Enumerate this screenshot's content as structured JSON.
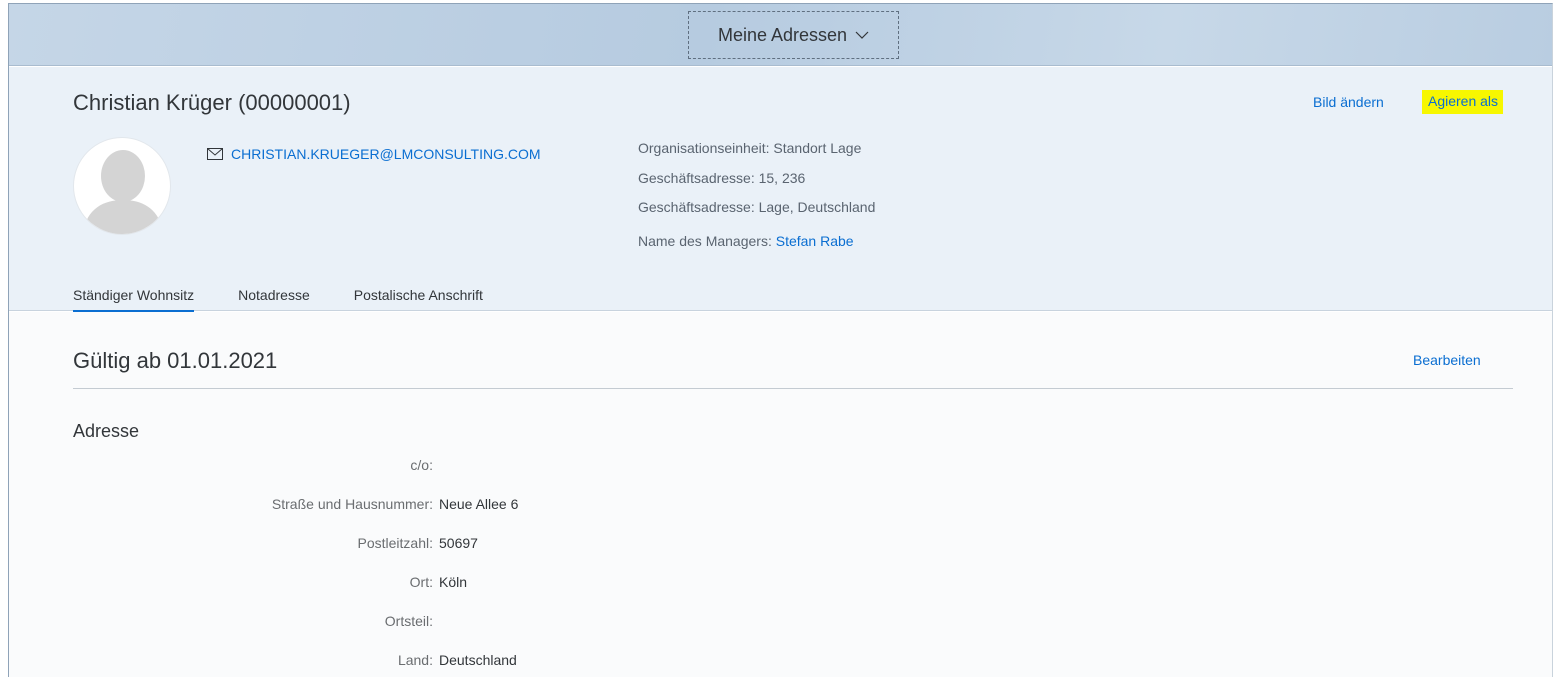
{
  "shell": {
    "app_title": "Meine Adressen"
  },
  "employee": {
    "name": "Christian Krüger (00000001)",
    "email": "CHRISTIAN.KRUEGER@LMCONSULTING.COM",
    "actions": {
      "change_picture": "Bild ändern",
      "act_as": "Agieren als"
    },
    "info": {
      "org_unit": "Organisationseinheit: Standort Lage",
      "business_address_1": "Geschäftsadresse: 15, 236",
      "business_address_2": "Geschäftsadresse: Lage, Deutschland",
      "manager_label": "Name des Managers:",
      "manager_name": "Stefan Rabe"
    }
  },
  "tabs": [
    {
      "label": "Ständiger Wohnsitz",
      "active": true
    },
    {
      "label": "Notadresse",
      "active": false
    },
    {
      "label": "Postalische Anschrift",
      "active": false
    }
  ],
  "section": {
    "title": "Gültig ab 01.01.2021",
    "edit_label": "Bearbeiten",
    "subtitle": "Adresse",
    "fields": [
      {
        "label": "c/o",
        "value": ""
      },
      {
        "label": "Straße und Hausnummer",
        "value": "Neue Allee 6"
      },
      {
        "label": "Postleitzahl",
        "value": "50697"
      },
      {
        "label": "Ort",
        "value": "Köln"
      },
      {
        "label": "Ortsteil",
        "value": ""
      },
      {
        "label": "Land",
        "value": "Deutschland"
      }
    ]
  },
  "colors": {
    "link": "#0a6ed1",
    "highlight": "#f7f700",
    "shell_bg": "#c0d3e5",
    "header_bg": "#eaf1f8"
  },
  "icons": {
    "email": "envelope-icon",
    "app_title_menu": "chevron-down-icon",
    "avatar": "person-placeholder-icon"
  }
}
